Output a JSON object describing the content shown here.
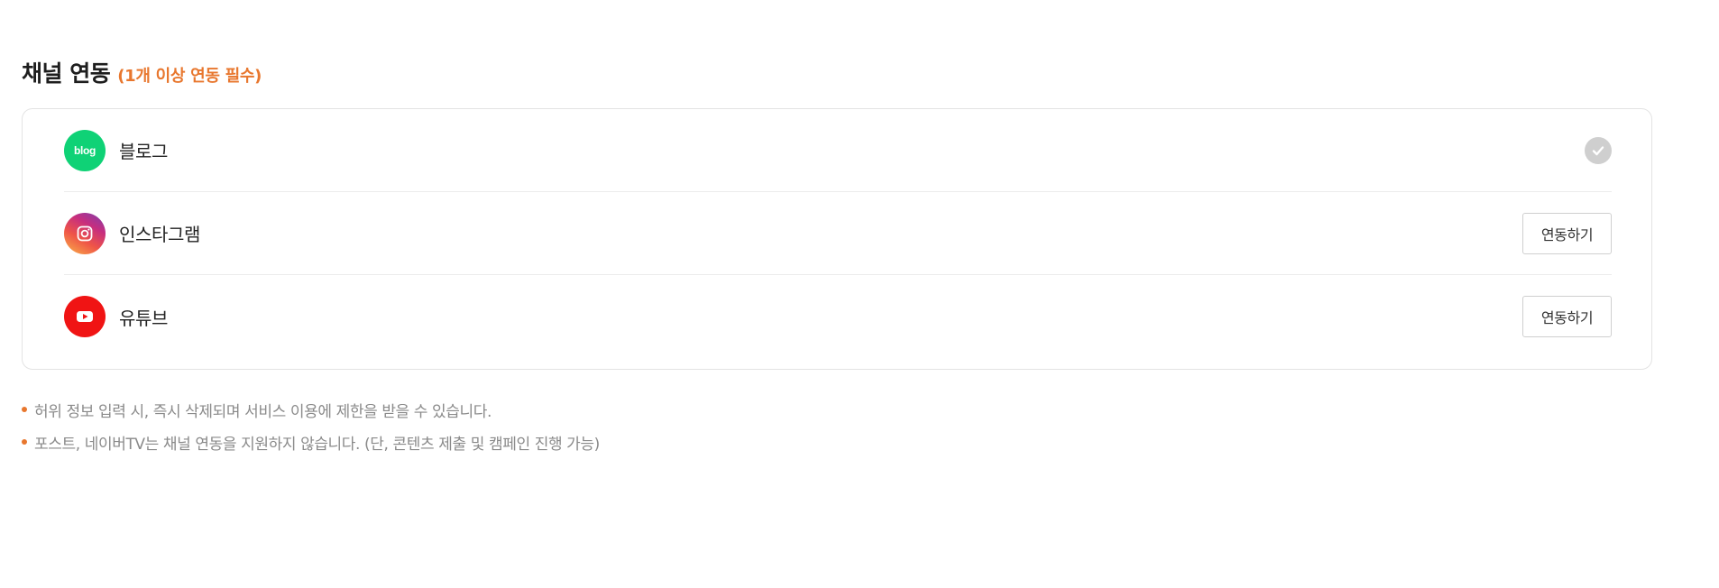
{
  "section": {
    "title": "채널 연동",
    "note": "(1개 이상 연동 필수)"
  },
  "channels": [
    {
      "name": "블로그",
      "logo_text": "blog",
      "icon": "blog-icon",
      "status": "connected",
      "color": "#0fd276"
    },
    {
      "name": "인스타그램",
      "icon": "instagram-icon",
      "status": "not-connected",
      "action_label": "연동하기",
      "color": "#c62e7f"
    },
    {
      "name": "유튜브",
      "icon": "youtube-icon",
      "status": "not-connected",
      "action_label": "연동하기",
      "color": "#f01414"
    }
  ],
  "notices": [
    "허위 정보 입력 시, 즉시 삭제되며 서비스 이용에 제한을 받을 수 있습니다.",
    "포스트, 네이버TV는 채널 연동을 지원하지 않습니다. (단, 콘텐츠 제출 및 캠페인 진행 가능)"
  ],
  "colors": {
    "accent": "#e8772e",
    "check": "#cfcfcf"
  }
}
